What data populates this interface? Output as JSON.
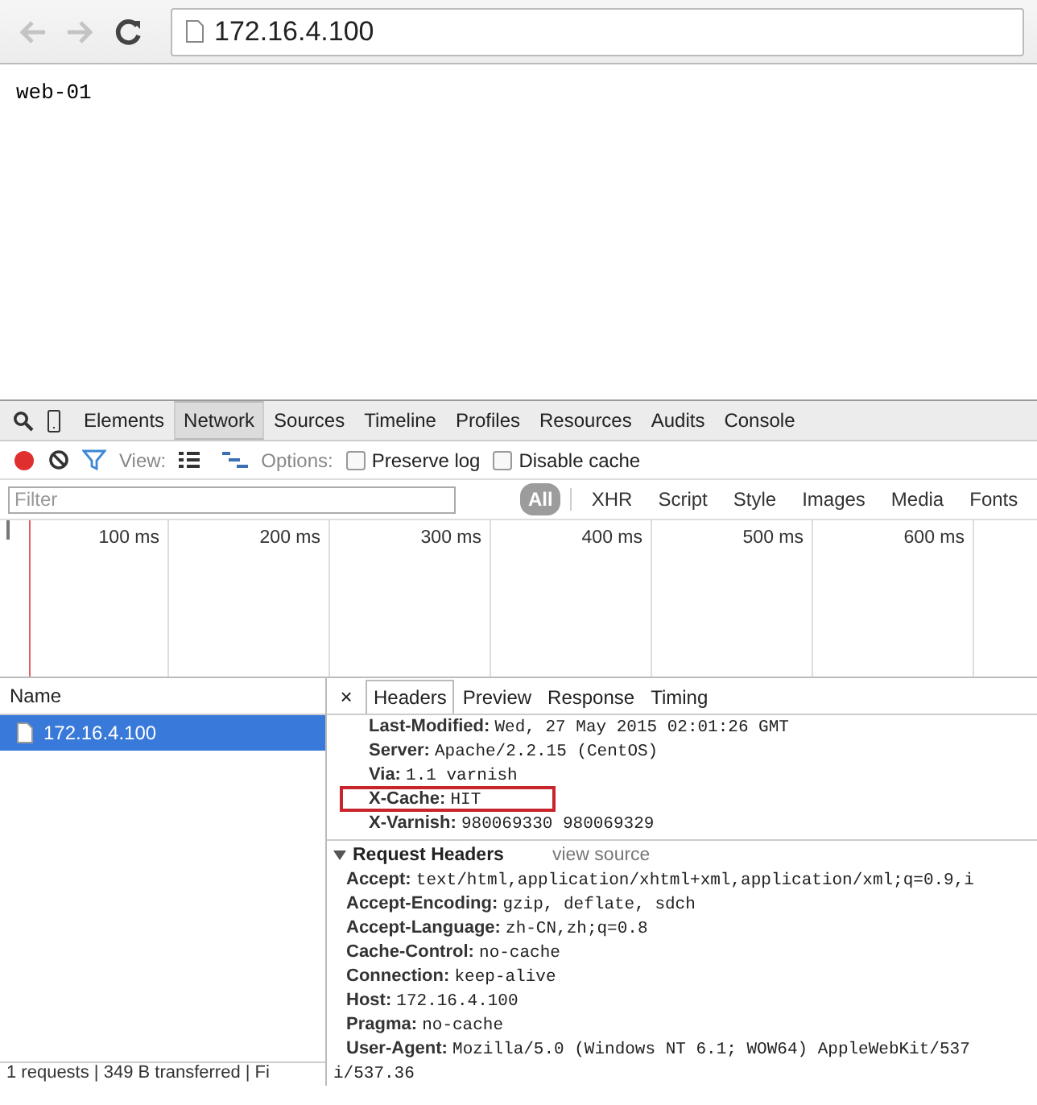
{
  "browser": {
    "back_disabled": true,
    "forward_disabled": true,
    "url": "172.16.4.100"
  },
  "page": {
    "text": "web-01"
  },
  "devtools": {
    "tabs": [
      {
        "label": "Elements",
        "selected": false
      },
      {
        "label": "Network",
        "selected": true
      },
      {
        "label": "Sources",
        "selected": false
      },
      {
        "label": "Timeline",
        "selected": false
      },
      {
        "label": "Profiles",
        "selected": false
      },
      {
        "label": "Resources",
        "selected": false
      },
      {
        "label": "Audits",
        "selected": false
      },
      {
        "label": "Console",
        "selected": false
      }
    ],
    "toolbar": {
      "recording": true,
      "view_label": "View:",
      "options_label": "Options:",
      "checkboxes": [
        {
          "label": "Preserve log",
          "checked": false
        },
        {
          "label": "Disable cache",
          "checked": false
        }
      ]
    },
    "filter": {
      "placeholder": "Filter",
      "types": [
        {
          "label": "All",
          "selected": true
        },
        {
          "label": "XHR",
          "selected": false
        },
        {
          "label": "Script",
          "selected": false
        },
        {
          "label": "Style",
          "selected": false
        },
        {
          "label": "Images",
          "selected": false
        },
        {
          "label": "Media",
          "selected": false
        },
        {
          "label": "Fonts",
          "selected": false
        }
      ]
    },
    "overview": {
      "ticks": [
        "100 ms",
        "200 ms",
        "300 ms",
        "400 ms",
        "500 ms",
        "600 ms"
      ]
    },
    "requests": {
      "column": "Name",
      "rows": [
        {
          "name": "172.16.4.100",
          "selected": true
        }
      ],
      "status": "1 requests | 349 B transferred | Fi"
    },
    "detail": {
      "close": "×",
      "tabs": [
        {
          "label": "Headers",
          "selected": true
        },
        {
          "label": "Preview",
          "selected": false
        },
        {
          "label": "Response",
          "selected": false
        },
        {
          "label": "Timing",
          "selected": false
        }
      ],
      "response_headers": [
        {
          "name": "Last-Modified:",
          "value": "Wed, 27 May 2015 02:01:26 GMT",
          "highlighted": false
        },
        {
          "name": "Server:",
          "value": "Apache/2.2.15 (CentOS)",
          "highlighted": false
        },
        {
          "name": "Via:",
          "value": "1.1 varnish",
          "highlighted": false
        },
        {
          "name": "X-Cache:",
          "value": "HIT",
          "highlighted": true
        },
        {
          "name": "X-Varnish:",
          "value": "980069330 980069329",
          "highlighted": false
        }
      ],
      "request_section": {
        "title": "Request Headers",
        "expanded": true,
        "link": "view source"
      },
      "request_headers": [
        {
          "name": "Accept:",
          "value": "text/html,application/xhtml+xml,application/xml;q=0.9,i"
        },
        {
          "name": "Accept-Encoding:",
          "value": "gzip, deflate, sdch"
        },
        {
          "name": "Accept-Language:",
          "value": "zh-CN,zh;q=0.8"
        },
        {
          "name": "Cache-Control:",
          "value": "no-cache"
        },
        {
          "name": "Connection:",
          "value": "keep-alive"
        },
        {
          "name": "Host:",
          "value": "172.16.4.100"
        },
        {
          "name": "Pragma:",
          "value": "no-cache"
        },
        {
          "name": "User-Agent:",
          "value": "Mozilla/5.0 (Windows NT 6.1; WOW64) AppleWebKit/537",
          "continuation": "i/537.36"
        }
      ]
    }
  }
}
